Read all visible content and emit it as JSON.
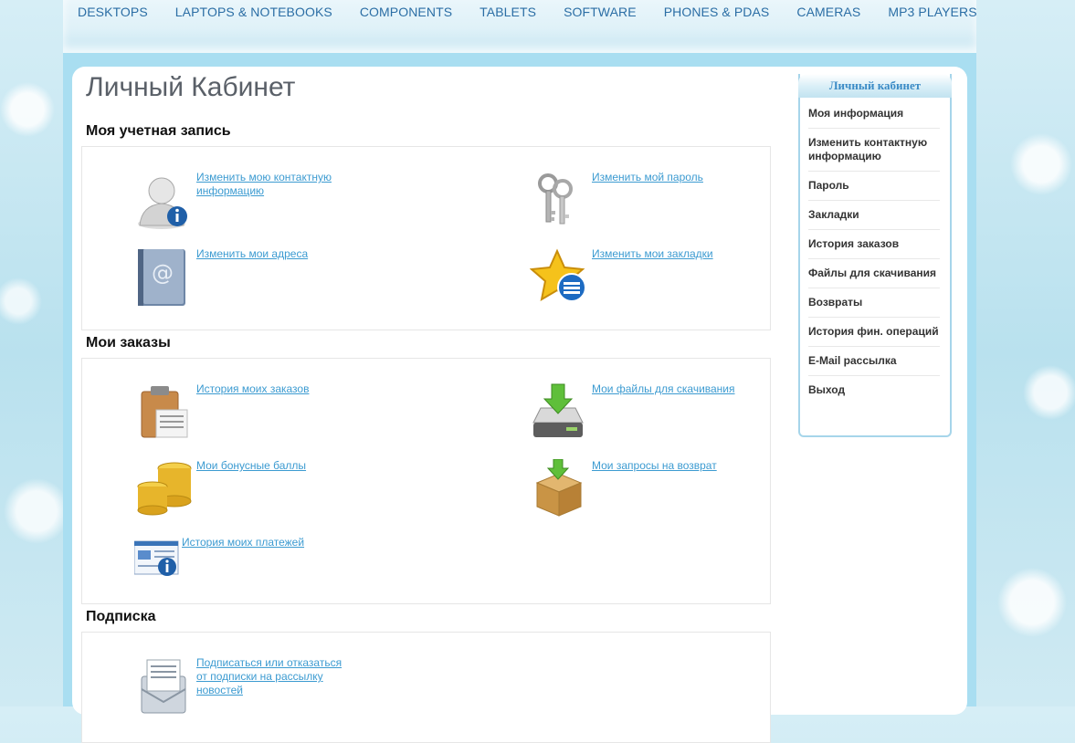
{
  "nav": {
    "items": [
      "Desktops",
      "Laptops & Notebooks",
      "Components",
      "Tablets",
      "Software",
      "Phones & PDAs",
      "Cameras",
      "MP3 Players"
    ]
  },
  "page": {
    "title": "Личный Кабинет"
  },
  "sections": {
    "account": {
      "heading": "Моя учетная запись",
      "links": {
        "edit_info": "Изменить мою контактную информацию",
        "edit_password": "Изменить мой пароль",
        "edit_addresses": "Изменить мои адреса",
        "edit_wishlist": "Изменить мои закладки"
      }
    },
    "orders": {
      "heading": "Мои заказы",
      "links": {
        "order_history": "История моих заказов",
        "downloads": "Мои файлы для скачивания",
        "reward_points": "Мои бонусные баллы",
        "returns": "Мои запросы на возврат",
        "transactions": "История моих платежей"
      }
    },
    "newsletter": {
      "heading": "Подписка",
      "links": {
        "subscribe": "Подписаться или отказаться от подписки на рассылку новостей"
      }
    }
  },
  "sidebar": {
    "title": "Личный кабинет",
    "items": [
      "Моя информация",
      "Изменить контактную информацию",
      "Пароль",
      "Закладки",
      "История заказов",
      "Файлы для скачивания",
      "Возвраты",
      "История фин. операций",
      "E-Mail рассылка",
      "Выход"
    ]
  },
  "icons": {
    "edit_info": "user-info-icon",
    "edit_password": "keys-icon",
    "edit_addresses": "address-book-icon",
    "edit_wishlist": "star-list-icon",
    "order_history": "clipboard-icon",
    "downloads": "download-drive-icon",
    "reward_points": "coins-icon",
    "returns": "return-box-icon",
    "transactions": "payment-card-icon",
    "subscribe": "newsletter-icon"
  },
  "colors": {
    "link": "#3c9bd1",
    "nav": "#2b6ea5",
    "frame": "#a9def1"
  }
}
